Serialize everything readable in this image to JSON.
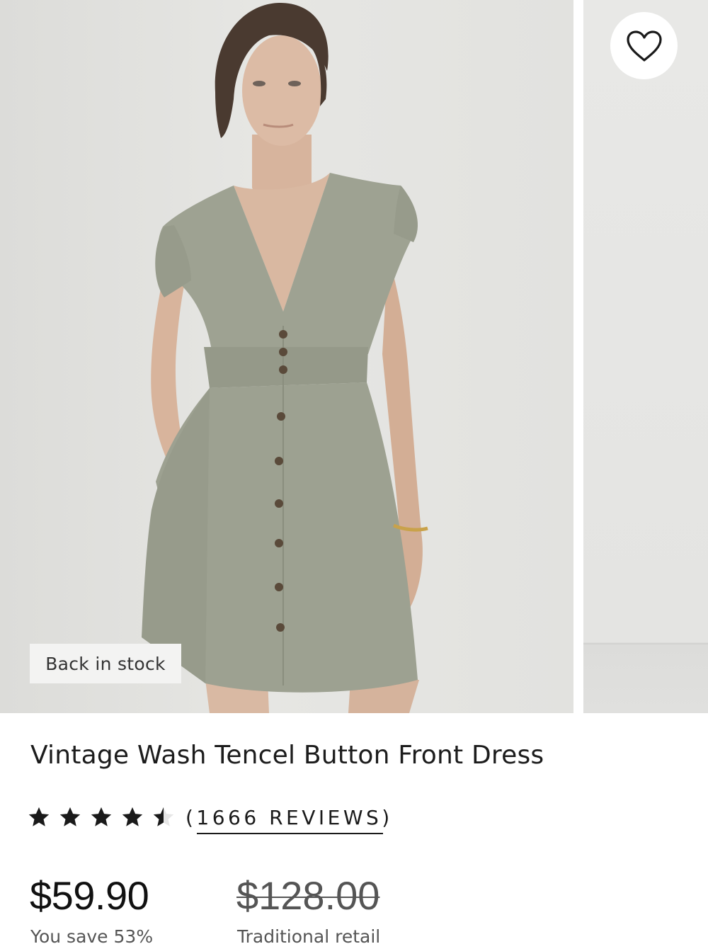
{
  "product": {
    "title": "Vintage Wash Tencel Button Front Dress",
    "badge": "Back in stock",
    "rating": 4.5,
    "rating_max": 5,
    "reviews_label": "(1666 REVIEWS)",
    "price": "$59.90",
    "original_price": "$128.00",
    "savings": "You save 53%",
    "original_label": "Traditional retail"
  },
  "icons": {
    "wishlist": "heart-outline-icon",
    "star_full": "star-icon",
    "star_half": "star-half-icon"
  },
  "colors": {
    "dress": "#9a9e8e",
    "background": "#e3e3e0",
    "text": "#1a1a1a"
  }
}
